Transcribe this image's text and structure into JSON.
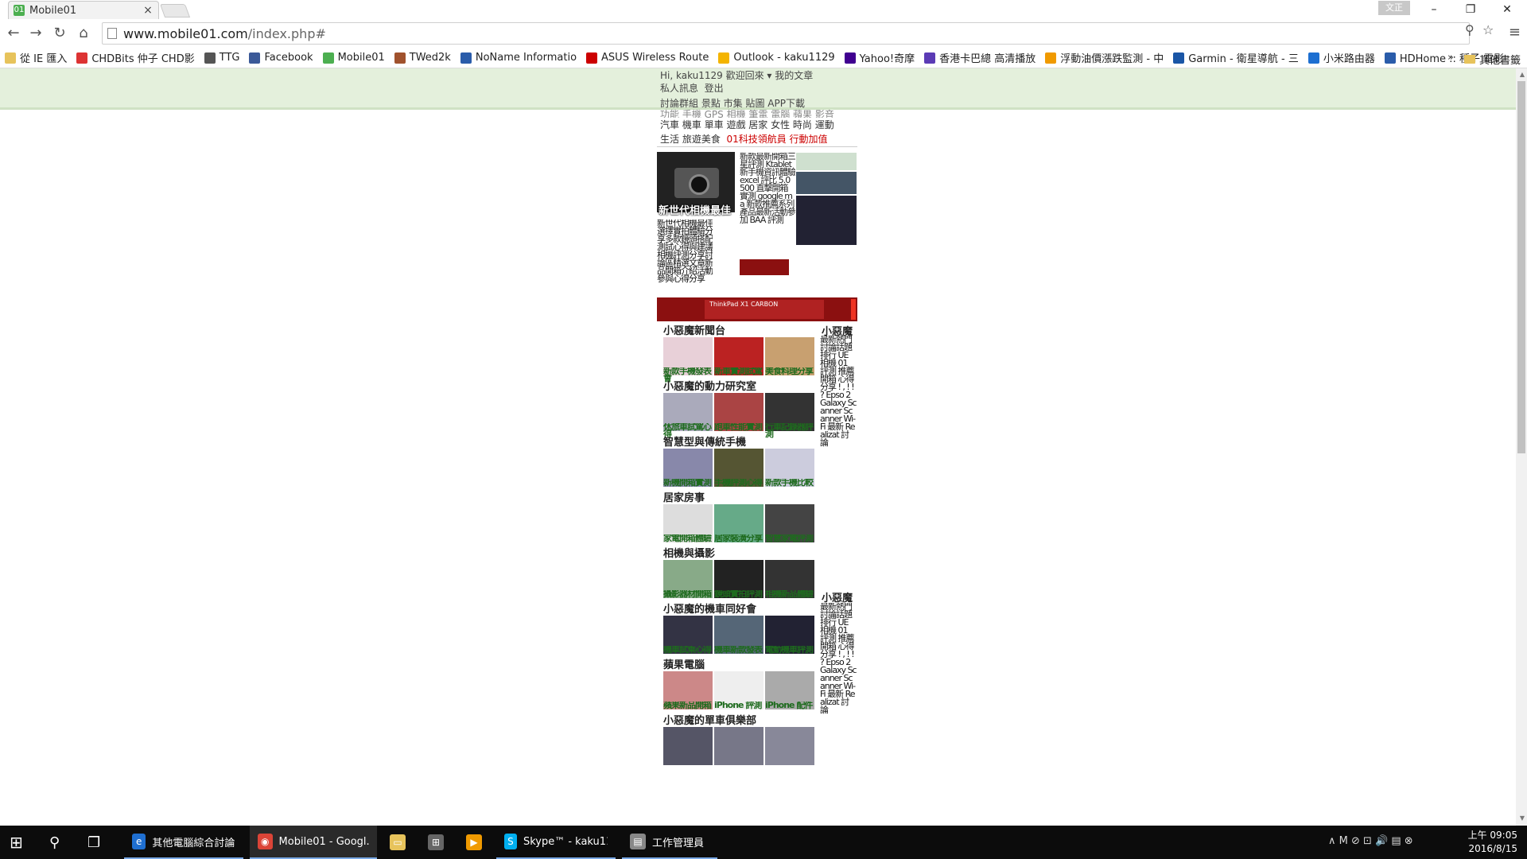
{
  "browser": {
    "tab_title": "Mobile01",
    "tab_close": "×",
    "profile_label": "文正",
    "window_controls": {
      "minimize": "–",
      "restore": "❐",
      "close": "✕"
    },
    "url_host": "www.mobile01.com",
    "url_path": "/index.php#",
    "nav_icons": {
      "back": "←",
      "forward": "→",
      "reload": "↻",
      "home": "⌂",
      "zoom": "⚲",
      "star": "☆",
      "menu": "≡"
    }
  },
  "bookmarks": [
    {
      "label": "從 IE 匯入",
      "color": "#e7c35b"
    },
    {
      "label": "CHDBits 仲子 CHD影",
      "color": "#d33"
    },
    {
      "label": "TTG",
      "color": "#555"
    },
    {
      "label": "Facebook",
      "color": "#3b5998"
    },
    {
      "label": "Mobile01",
      "color": "#4caf50"
    },
    {
      "label": "TWed2k",
      "color": "#a0522d"
    },
    {
      "label": "NoName Informatio",
      "color": "#2a5caa"
    },
    {
      "label": "ASUS Wireless Route",
      "color": "#c00"
    },
    {
      "label": "Outlook - kaku1129",
      "color": "#f4b400"
    },
    {
      "label": "Yahoo!奇摩",
      "color": "#400090"
    },
    {
      "label": "香港卡巴總 高清播放",
      "color": "#5b3bb5"
    },
    {
      "label": "浮動油價漲跌監測 - 中",
      "color": "#f09a00"
    },
    {
      "label": "Garmin - 衛星導航 - 三",
      "color": "#1a56a6"
    },
    {
      "label": "小米路由器",
      "color": "#1d6fd1"
    },
    {
      "label": "HDHome :: 種子 電影",
      "color": "#2a5caa"
    }
  ],
  "bookmarks_more": "»",
  "bookmarks_other": "其他書籤",
  "site": {
    "user_greeting": "Hi, kaku1129 歡迎回來 ▾",
    "my_articles": "我的文章",
    "private_msg": "私人訊息",
    "logout": "登出",
    "nav_main": "討論群組  景點  市集  貼圖  APP下載",
    "nav_categories_partial": "功能  手機  GPS  相機  筆電  電腦  蘋果  影音",
    "nav_categories_2": "汽車  機車  單車  遊戲  居家  女性  時尚  運動",
    "nav_categories_3": "生活  旅遊美食",
    "nav_special": "01科技領航員  行動加值",
    "feature_title": "新世代相機最佳",
    "feature_text": "新世代相機最佳選擇實拍體驗分享多款鏡頭搭配測試心得與建議相機評測分享討論區精選文章新品開箱介紹活動參與心得分享",
    "middle_text": "新款最新開箱三星評測 Ktablet 新手機資訊體驗 excel 評比 5.0 500 直擊開箱實測 google ma 新款推薦系列產品最新活動參加 BAA 評測",
    "ad_banner_text": "ThinkPad X1 CARBON",
    "sections": [
      {
        "title": "小惡魔新聞台",
        "captions": [
          "新款手機發表會",
          "新車實測試駕",
          "美食料理分享"
        ]
      },
      {
        "title": "小惡魔的動力研究室",
        "captions": [
          "休旅車試駕心得",
          "跑車性能實測",
          "行車記錄器評測"
        ]
      },
      {
        "title": "智慧型與傳統手機",
        "captions": [
          "新機開箱實測",
          "手機評測心得",
          "新款手機比較"
        ]
      },
      {
        "title": "居家房事",
        "captions": [
          "家電開箱體驗",
          "居家裝潢分享",
          "智慧家電評測"
        ]
      },
      {
        "title": "相機與攝影",
        "captions": [
          "攝影器材開箱",
          "鏡頭實拍評測",
          "相機新品體驗"
        ]
      },
      {
        "title": "小惡魔的機車同好會",
        "captions": [
          "機車試乘心得",
          "機車新款發表",
          "電動機車評測"
        ]
      },
      {
        "title": "蘋果電腦",
        "captions": [
          "蘋果新品開箱",
          "iPhone 評測",
          "iPhone 配件"
        ]
      },
      {
        "title": "小惡魔的單車俱樂部",
        "captions": [
          "",
          "",
          ""
        ]
      }
    ],
    "side_title_1": "小惡魔",
    "side_title_2": "小惡魔",
    "side_text": "最新熱門討論話題排行 UE 相機 01 評測 推薦 開箱 心得 分享 ! , ! ! ? Epso 2 Galaxy Scanner Scanner Wi-Fi 最新 Realizat 討論"
  },
  "taskbar": {
    "apps": [
      {
        "label": "其他電腦綜合討論 ...",
        "color": "#1f6fd1",
        "glyph": "e"
      },
      {
        "label": "Mobile01 - Googl...",
        "color": "#db4437",
        "glyph": "◉"
      },
      {
        "label": "",
        "color": "#e7c35b",
        "glyph": "▭"
      },
      {
        "label": "",
        "color": "#666",
        "glyph": "⊞"
      },
      {
        "label": "",
        "color": "#f09a00",
        "glyph": "▶"
      },
      {
        "label": "Skype™ - kaku112...",
        "color": "#00aff0",
        "glyph": "S"
      },
      {
        "label": "工作管理員",
        "color": "#888",
        "glyph": "▤"
      }
    ],
    "start_glyph": "⊞",
    "search_glyph": "⚲",
    "taskview_glyph": "❐",
    "tray_glyphs": "∧  M  ⊘  ⊡  🔊  ▤  ⊗",
    "time": "上午 09:05",
    "date": "2016/8/15"
  }
}
